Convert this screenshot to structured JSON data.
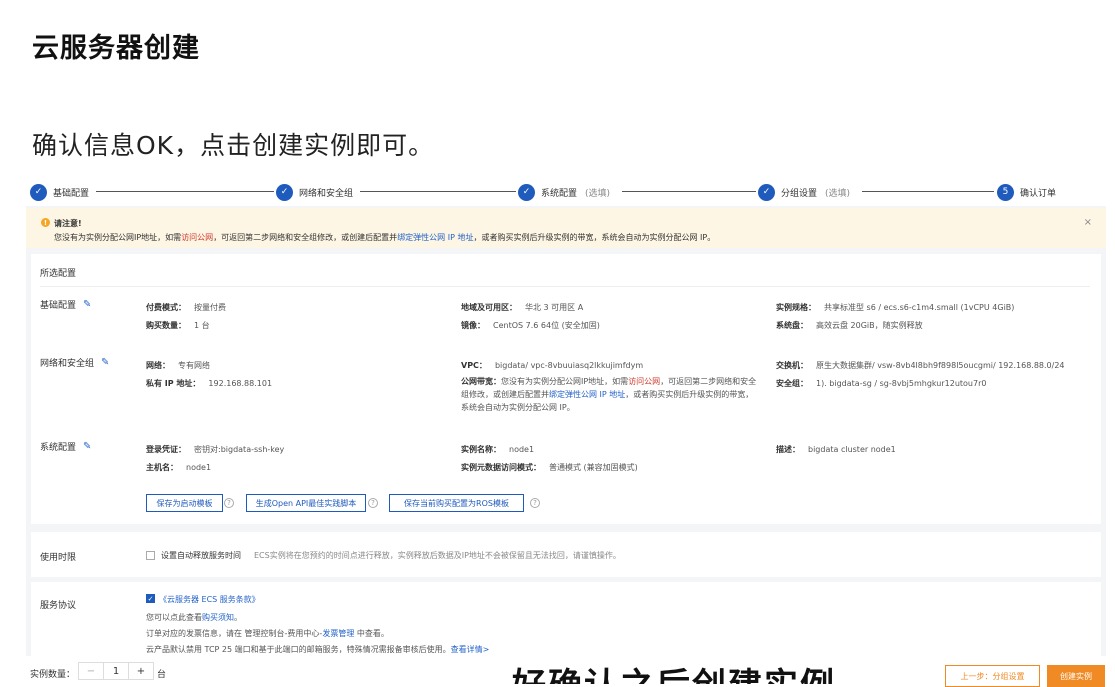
{
  "slide": {
    "title": "云服务器创建",
    "subtitle": "确认信息OK，点击创建实例即可。",
    "caption": "好确认之后创建实例"
  },
  "steps": [
    {
      "num": "✓",
      "label": "基础配置",
      "optional": ""
    },
    {
      "num": "✓",
      "label": "网络和安全组",
      "optional": ""
    },
    {
      "num": "✓",
      "label": "系统配置",
      "optional": "(选填)"
    },
    {
      "num": "✓",
      "label": "分组设置",
      "optional": "(选填)"
    },
    {
      "num": "5",
      "label": "确认订单",
      "optional": ""
    }
  ],
  "warning": {
    "title": "请注意!",
    "text_1": "您没有为实例分配公网IP地址，如需",
    "link_1": "访问公网",
    "text_2": "，可返回第二步网络和安全组修改，或创建后配置并",
    "link_2": "绑定弹性公网 IP 地址",
    "text_3": "，或者购买实例后升级实例的带宽，系统会自动为实例分配公网 IP。",
    "close": "×"
  },
  "summary": {
    "header": "所选配置",
    "basic": {
      "label": "基础配置",
      "billing_k": "付费模式：",
      "billing_v": "按量付费",
      "qty_k": "购买数量：",
      "qty_v": "1 台",
      "region_k": "地域及可用区：",
      "region_v": "华北 3 可用区 A",
      "image_k": "镜像：",
      "image_v": "CentOS 7.6 64位 (安全加固)",
      "spec_k": "实例规格：",
      "spec_v": "共享标准型 s6 / ecs.s6-c1m4.small (1vCPU 4GiB)",
      "disk_k": "系统盘：",
      "disk_v": "高效云盘 20GiB，随实例释放"
    },
    "network": {
      "label": "网络和安全组",
      "net_k": "网络：",
      "net_v": "专有网络",
      "ip_k": "私有 IP 地址：",
      "ip_v": "192.168.88.101",
      "vpc_k": "VPC：",
      "vpc_v": "bigdata/ vpc-8vbuuiasq2lkkujimfdym",
      "bw_k": "公网带宽：",
      "bw_v1": "您没有为实例分配公网IP地址，如需",
      "bw_link1": "访问公网",
      "bw_v2": "，可返回第二步网络和安全组修改，或创建后配置并",
      "bw_link2": "绑定弹性公网 IP 地址",
      "bw_v3": "，或者购买实例后升级实例的带宽，系统会自动为实例分配公网 IP。",
      "switch_k": "交换机：",
      "switch_v": "原生大数据集群/ vsw-8vb4l8bh9f898l5oucgmi/ 192.168.88.0/24",
      "sg_k": "安全组：",
      "sg_v": "1). bigdata-sg / sg-8vbj5mhgkur12utou7r0"
    },
    "system": {
      "label": "系统配置",
      "login_k": "登录凭证：",
      "login_v": "密钥对:bigdata-ssh-key",
      "host_k": "主机名：",
      "host_v": "node1",
      "name_k": "实例名称：",
      "name_v": "node1",
      "meta_k": "实例元数据访问模式：",
      "meta_v": "普通模式 (兼容加固模式)",
      "desc_k": "描述：",
      "desc_v": "bigdata cluster node1"
    },
    "buttons": {
      "save_template": "保存为启动模板",
      "openapi": "生成Open API最佳实践脚本",
      "ros": "保存当前购买配置为ROS模板"
    }
  },
  "usage": {
    "label": "使用时限",
    "checkbox_label": "设置自动释放服务时间",
    "hint": "ECS实例将在您预约的时间点进行释放，实例释放后数据及IP地址不会被保留且无法找回，请谨慎操作。"
  },
  "agreement": {
    "label": "服务协议",
    "terms": "《云服务器 ECS 服务条款》",
    "line1_a": "您可以点此查看",
    "line1_link": "购买须知",
    "line1_b": "。",
    "line2_a": "订单对应的发票信息，请在 管理控制台-费用中心-",
    "line2_link": "发票管理",
    "line2_b": " 中查看。",
    "line3_a": "云产品默认禁用 TCP 25 端口和基于此端口的邮箱服务，特殊情况需报备审核后使用。",
    "line3_link": "查看详情>"
  },
  "footer": {
    "qty_label": "实例数量：",
    "minus": "−",
    "qty": "1",
    "plus": "+",
    "unit": "台",
    "prev": "上一步：分组设置",
    "create": "创建实例"
  }
}
